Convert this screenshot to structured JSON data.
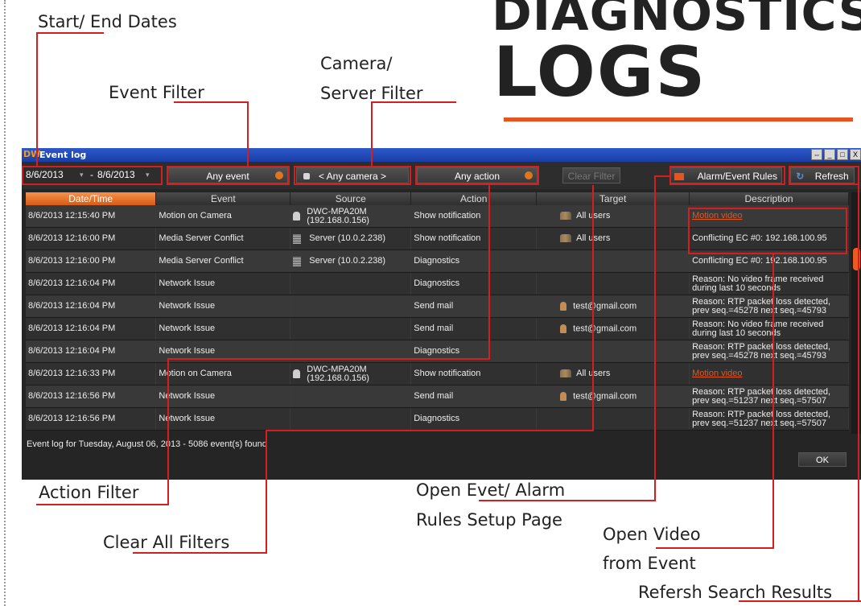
{
  "page": {
    "title_line1": "DIAGNOSTICS",
    "title_line2": "LOGS"
  },
  "callouts": {
    "start_end_dates": "Start/ End Dates",
    "event_filter": "Event Filter",
    "camera_server_filter_line1": "Camera/",
    "camera_server_filter_line2": "Server Filter",
    "action_filter": "Action Filter",
    "clear_all_filters": "Clear All Filters",
    "open_rules_line1": "Open Evet/ Alarm",
    "open_rules_line2": "Rules Setup Page",
    "open_video_line1": "Open Video",
    "open_video_line2": "from Event",
    "refresh_results": "Refersh Search Results"
  },
  "window": {
    "logo": "DW",
    "title": "Event log",
    "controls": [
      "⇔",
      "_",
      "□",
      "X"
    ]
  },
  "toolbar": {
    "start_date": "8/6/2013",
    "end_date": "8/6/2013",
    "date_separator": "-",
    "event_filter": "Any event",
    "camera_filter": "< Any camera >",
    "action_filter": "Any action",
    "clear_filter": "Clear Filter",
    "rules_button": "Alarm/Event Rules",
    "refresh_button": "Refresh"
  },
  "table": {
    "columns": [
      "Date/Time",
      "Event",
      "Source",
      "Action",
      "Target",
      "Description"
    ],
    "rows": [
      {
        "datetime": "8/6/2013 12:15:40 PM",
        "event": "Motion on Camera",
        "source": "DWC-MPA20M",
        "source2": "(192.168.0.156)",
        "source_icon": "camera-icon",
        "action": "Show notification",
        "target": "All users",
        "target_icon": "users-icon",
        "description": "Motion video",
        "desc_link": true
      },
      {
        "datetime": "8/6/2013 12:16:00 PM",
        "event": "Media Server Conflict",
        "source": "Server (10.0.2.238)",
        "source2": "",
        "source_icon": "server-icon",
        "action": "Show notification",
        "target": "All users",
        "target_icon": "users-icon",
        "description": "Conflicting EC #0: 192.168.100.95",
        "desc_link": false
      },
      {
        "datetime": "8/6/2013 12:16:00 PM",
        "event": "Media Server Conflict",
        "source": "Server (10.0.2.238)",
        "source2": "",
        "source_icon": "server-icon",
        "action": "Diagnostics",
        "target": "",
        "target_icon": "",
        "description": "Conflicting EC #0: 192.168.100.95",
        "desc_link": false
      },
      {
        "datetime": "8/6/2013 12:16:04 PM",
        "event": "Network Issue",
        "source": "",
        "source2": "",
        "source_icon": "",
        "action": "Diagnostics",
        "target": "",
        "target_icon": "",
        "description": "Reason: No video frame received during last 10 seconds",
        "desc_link": false
      },
      {
        "datetime": "8/6/2013 12:16:04 PM",
        "event": "Network Issue",
        "source": "",
        "source2": "",
        "source_icon": "",
        "action": "Send mail",
        "target": "test@gmail.com",
        "target_icon": "user-icon",
        "description": "Reason: RTP packet loss detected, prev seq.=45278 next seq.=45793",
        "desc_link": false
      },
      {
        "datetime": "8/6/2013 12:16:04 PM",
        "event": "Network Issue",
        "source": "",
        "source2": "",
        "source_icon": "",
        "action": "Send mail",
        "target": "test@gmail.com",
        "target_icon": "user-icon",
        "description": "Reason: No video frame received during last 10 seconds",
        "desc_link": false
      },
      {
        "datetime": "8/6/2013 12:16:04 PM",
        "event": "Network Issue",
        "source": "",
        "source2": "",
        "source_icon": "",
        "action": "Diagnostics",
        "target": "",
        "target_icon": "",
        "description": "Reason: RTP packet loss detected, prev seq.=45278 next seq.=45793",
        "desc_link": false
      },
      {
        "datetime": "8/6/2013 12:16:33 PM",
        "event": "Motion on Camera",
        "source": "DWC-MPA20M",
        "source2": "(192.168.0.156)",
        "source_icon": "camera-icon",
        "action": "Show notification",
        "target": "All users",
        "target_icon": "users-icon",
        "description": "Motion video",
        "desc_link": true
      },
      {
        "datetime": "8/6/2013 12:16:56 PM",
        "event": "Network Issue",
        "source": "",
        "source2": "",
        "source_icon": "",
        "action": "Send mail",
        "target": "test@gmail.com",
        "target_icon": "user-icon",
        "description": "Reason: RTP packet loss detected, prev seq.=51237 next seq.=57507",
        "desc_link": false
      },
      {
        "datetime": "8/6/2013 12:16:56 PM",
        "event": "Network Issue",
        "source": "",
        "source2": "",
        "source_icon": "",
        "action": "Diagnostics",
        "target": "",
        "target_icon": "",
        "description": "Reason: RTP packet loss detected, prev seq.=51237 next seq.=57507",
        "desc_link": false
      }
    ]
  },
  "status": {
    "text": "Event log for Tuesday, August 06, 2013  - 5086 event(s) found",
    "ok_button": "OK"
  },
  "colors": {
    "accent": "#e8541d",
    "callout_line": "#d31f1f"
  }
}
